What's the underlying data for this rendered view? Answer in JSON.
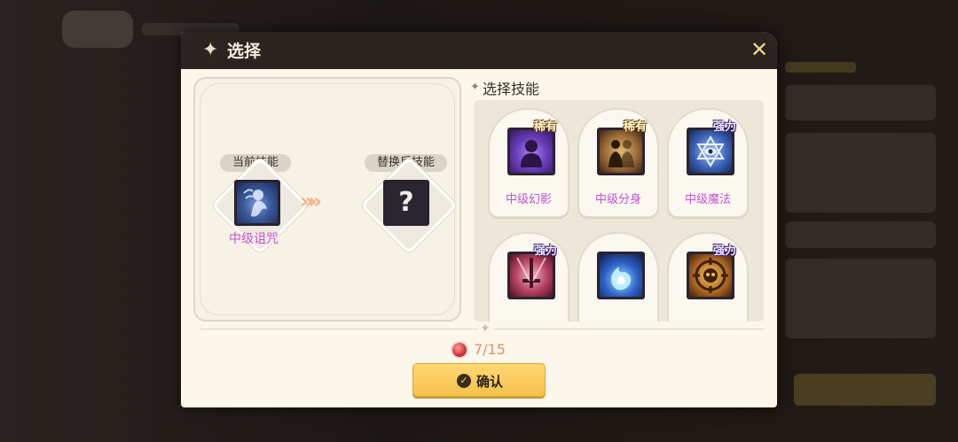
{
  "dialog": {
    "title": "选择",
    "close_icon": "close-icon"
  },
  "current": {
    "label": "当前技能",
    "skill_name": "中级诅咒",
    "icon": "curse-skill-icon"
  },
  "replacement": {
    "label": "替换后技能",
    "placeholder_glyph": "?"
  },
  "arrow_glyph": "»»",
  "selection": {
    "title": "选择技能",
    "skills": [
      {
        "name": "中级幻影",
        "tag": "稀有",
        "icon": "phantom-skill-icon"
      },
      {
        "name": "中级分身",
        "tag": "稀有",
        "icon": "clone-skill-icon"
      },
      {
        "name": "中级魔法",
        "tag": "强力",
        "icon": "magic-skill-icon"
      },
      {
        "name": "",
        "tag": "强力",
        "icon": "sword-skill-icon"
      },
      {
        "name": "",
        "tag": "",
        "icon": "blue-flame-skill-icon"
      },
      {
        "name": "",
        "tag": "强力",
        "icon": "target-skill-icon"
      }
    ]
  },
  "cost": {
    "text": "7/15",
    "icon": "red-gem-icon"
  },
  "confirm": {
    "label": "确认",
    "icon": "check-icon"
  }
}
